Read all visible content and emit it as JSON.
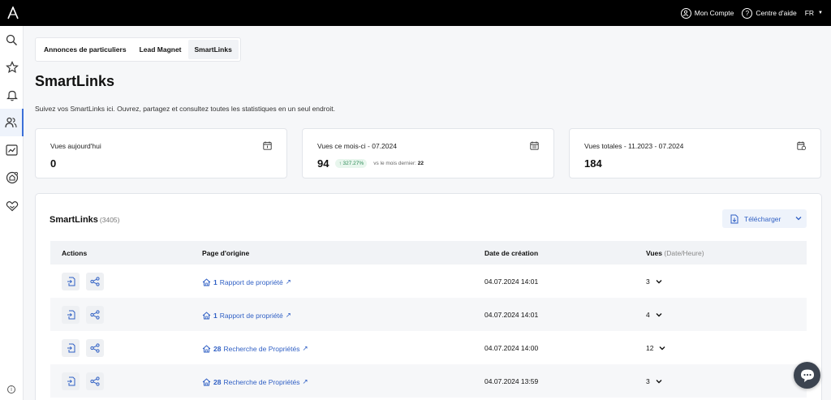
{
  "topbar": {
    "account_label": "Mon Compte",
    "help_label": "Centre d'aide",
    "lang": "FR"
  },
  "sidebar": {
    "items": [
      {
        "icon": "search-icon"
      },
      {
        "icon": "star-icon"
      },
      {
        "icon": "bell-icon"
      },
      {
        "icon": "users-icon",
        "active": true
      },
      {
        "icon": "chart-icon"
      },
      {
        "icon": "home-target-icon"
      },
      {
        "icon": "handshake-icon"
      }
    ]
  },
  "tabs": [
    {
      "label": "Annonces de particuliers"
    },
    {
      "label": "Lead Magnet"
    },
    {
      "label": "SmartLinks",
      "active": true
    }
  ],
  "page": {
    "title": "SmartLinks",
    "subtitle": "Suivez vos SmartLinks ici. Ouvrez, partagez et consultez toutes les statistiques en un seul endroit."
  },
  "stats": [
    {
      "label": "Vues aujourd'hui",
      "value": "0"
    },
    {
      "label": "Vues ce mois-ci - 07.2024",
      "value": "94",
      "badge": "↑ 327.27%",
      "vs_text": "vs le mois dernier:",
      "vs_value": "22"
    },
    {
      "label": "Vues totales - 11.2023 - 07.2024",
      "value": "184"
    }
  ],
  "table": {
    "title": "SmartLinks",
    "count": "(3405)",
    "download_label": "Télécharger",
    "headers": {
      "actions": "Actions",
      "origin": "Page d'origine",
      "date": "Date de création",
      "views": "Vues",
      "views_sub": "(Date/Heure)"
    },
    "rows": [
      {
        "origin_num": "1",
        "origin_text": "Rapport de propriété",
        "date": "04.07.2024 14:01",
        "views": "3"
      },
      {
        "origin_num": "1",
        "origin_text": "Rapport de propriété",
        "date": "04.07.2024 14:01",
        "views": "4"
      },
      {
        "origin_num": "28",
        "origin_text": "Recherche de Propriétés",
        "date": "04.07.2024 14:00",
        "views": "12"
      },
      {
        "origin_num": "28",
        "origin_text": "Recherche de Propriétés",
        "date": "04.07.2024 13:59",
        "views": "3"
      }
    ]
  },
  "colors": {
    "accent": "#2f5fc4",
    "topbar": "#000000",
    "badge_green": "#2e8b57"
  }
}
